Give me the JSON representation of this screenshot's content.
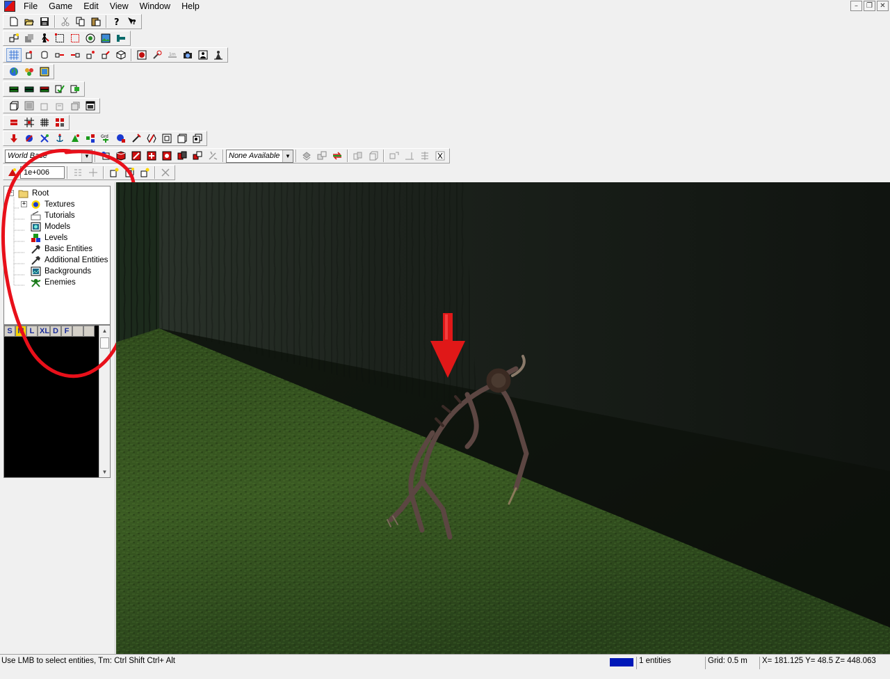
{
  "menu": [
    "File",
    "Game",
    "Edit",
    "View",
    "Window",
    "Help"
  ],
  "window_controls": {
    "minimize": "–",
    "restore": "❐",
    "close": "✕"
  },
  "toolbar": {
    "base_combo": "World Base",
    "value_field": "1e+006",
    "availability_combo": "None Available",
    "combo_arrow": "▼"
  },
  "tree": {
    "root": "Root",
    "expander_collapse": "−",
    "expander_expand": "+",
    "items": [
      "Textures",
      "Tutorials",
      "Models",
      "Levels",
      "Basic Entities",
      "Additional Entities",
      "Backgrounds",
      "Enemies"
    ]
  },
  "browser": {
    "size_tabs": [
      "S",
      "M",
      "L",
      "XL",
      "D",
      "F",
      "",
      ""
    ],
    "active_tab": "M",
    "scroll_up": "▲",
    "scroll_down": "▼"
  },
  "status": {
    "hint": "Use LMB to select entities, Tm: Ctrl Shift Ctrl+ Alt",
    "entities": "1 entities",
    "grid": "Grid: 0.5 m",
    "coords": "X= 181.125 Y= 48.5 Z= 448.063",
    "color_swatch": "#0018b8"
  },
  "colors": {
    "annotation_red": "#e8101a",
    "marker_arrow": "#e01818",
    "grass": "#3c5e24",
    "wall": "#1b211b",
    "tab_active": "#f5d200"
  }
}
